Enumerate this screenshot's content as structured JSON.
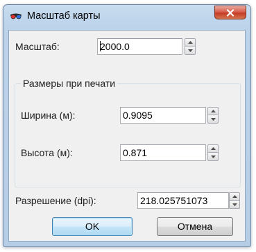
{
  "window": {
    "title": "Масштаб карты",
    "close_glyph": "x"
  },
  "scale": {
    "label": "Масштаб:",
    "value": "2000.0"
  },
  "print_size": {
    "group_title": "Размеры при печати",
    "width_label": "Ширина (м):",
    "width_value": "0.9095",
    "height_label": "Высота (м):",
    "height_value": "0.871"
  },
  "resolution": {
    "label": "Разрешение (dpi):",
    "value": "218.025751073"
  },
  "buttons": {
    "ok": "OK",
    "cancel": "Отмена"
  },
  "icons": {
    "app": "3d-glasses-icon",
    "spin_up": "chevron-up-icon",
    "spin_down": "chevron-down-icon"
  },
  "colors": {
    "close_button": "#c43c26",
    "frame": "#b6cde6",
    "default_button": "#3c7fb1"
  }
}
